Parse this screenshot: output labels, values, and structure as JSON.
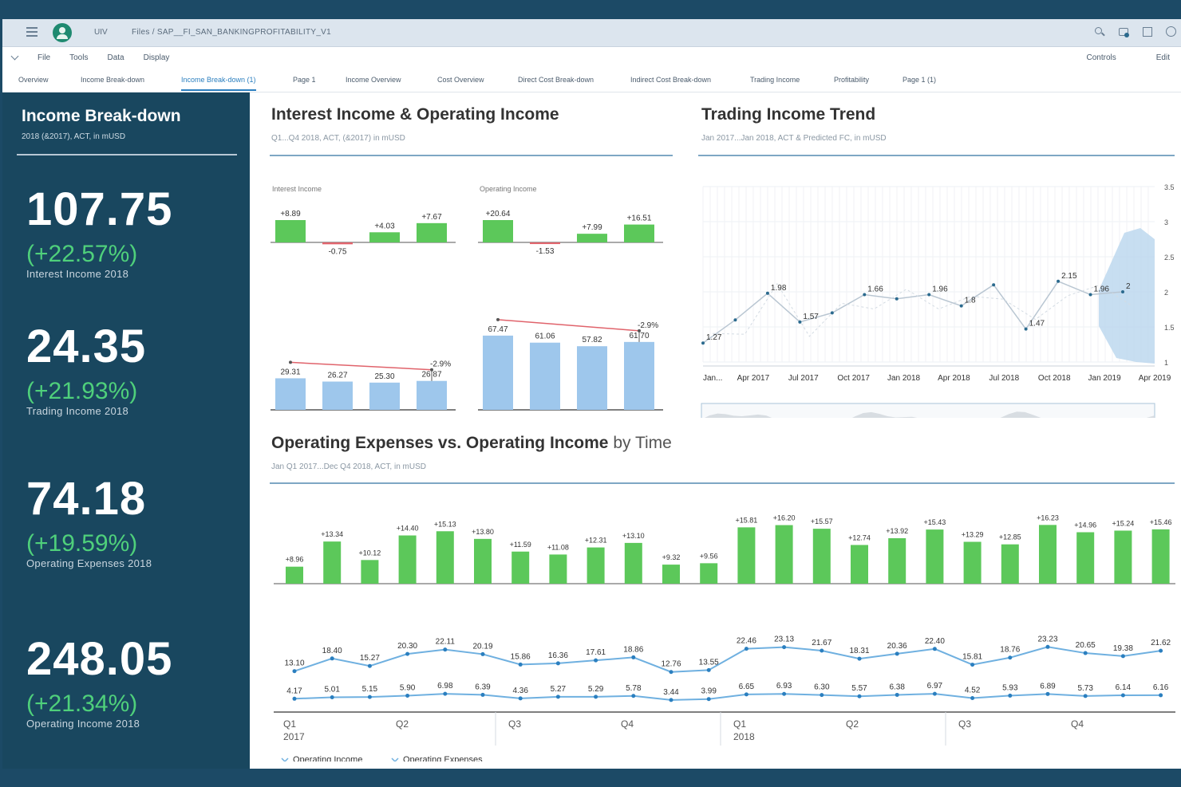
{
  "shell": {
    "app": "UIV",
    "breadcrumb": "Files / SAP__FI_SAN_BANKINGPROFITABILITY_V1"
  },
  "menu": {
    "items": [
      "File",
      "Tools",
      "Data",
      "Display"
    ],
    "right": [
      "Controls",
      "Edit"
    ]
  },
  "tabs": [
    "Overview",
    "Income Break-down",
    "Income Break-down (1)",
    "Page 1",
    "Income Overview",
    "Cost Overview",
    "Direct Cost Break-down",
    "Indirect Cost Break-down",
    "Trading Income",
    "Profitability",
    "Page 1 (1)"
  ],
  "active_tab": "Income Break-down (1)",
  "kpi_panel": {
    "title": "Income Break-down",
    "subtitle": "2018 (&2017), ACT, in mUSD",
    "kpis": [
      {
        "value": "107.75",
        "change": "(+22.57%)",
        "label": "Interest Income 2018"
      },
      {
        "value": "24.35",
        "change": "(+21.93%)",
        "label": "Trading Income 2018"
      },
      {
        "value": "74.18",
        "change": "(+19.59%)",
        "label": "Operating Expenses 2018"
      },
      {
        "value": "248.05",
        "change": "(+21.34%)",
        "label": "Operating Income 2018"
      }
    ]
  },
  "interest_chart": {
    "title": "Interest Income & Operating Income",
    "subtitle": "Q1...Q4 2018, ACT, (&2017) in mUSD"
  },
  "trend_chart": {
    "title": "Trading Income Trend",
    "subtitle": "Jan 2017...Jan 2018, ACT & Predicted FC, in mUSD"
  },
  "opex_chart": {
    "title": "Operating Expenses vs. Operating Income",
    "title_suffix": "by Time",
    "subtitle": "Jan Q1 2017...Dec Q4 2018, ACT, in mUSD",
    "legend": [
      "Operating Income",
      "Operating Expenses"
    ]
  },
  "colors": {
    "panel": "#19475f",
    "green": "#5cc85a",
    "negative": "#e0636b",
    "bar_blue": "#9ec7ec",
    "line_blue": "#6fb0e0",
    "accent": "#2b7fbf"
  },
  "chart_data": [
    {
      "type": "bar",
      "title": "Interest Income",
      "categories": [
        "Q1",
        "Q2",
        "Q3",
        "Q4"
      ],
      "variance_values": [
        8.89,
        -0.75,
        4.03,
        7.67
      ],
      "variance_labels": [
        "+8.89",
        "-0.75",
        "+4.03",
        "+7.67"
      ],
      "values": [
        29.31,
        26.27,
        25.3,
        26.87
      ],
      "value_labels": [
        "29.31",
        "26.27",
        "25.30",
        "26.87"
      ],
      "trend_label": "-2.9%",
      "ylim": [
        0,
        40
      ]
    },
    {
      "type": "bar",
      "title": "Operating Income",
      "categories": [
        "Q1",
        "Q2",
        "Q3",
        "Q4"
      ],
      "variance_values": [
        20.64,
        -1.53,
        7.99,
        16.51
      ],
      "variance_labels": [
        "+20.64",
        "-1.53",
        "+7.99",
        "+16.51"
      ],
      "values": [
        67.47,
        61.06,
        57.82,
        61.7
      ],
      "value_labels": [
        "67.47",
        "61.06",
        "57.82",
        "61.70"
      ],
      "trend_label": "-2.9%",
      "ylim": [
        0,
        80
      ]
    },
    {
      "type": "line",
      "title": "Trading Income Trend",
      "x": [
        "Jan...",
        "Apr 2017",
        "Jul 2017",
        "Oct 2017",
        "Jan 2018",
        "Apr 2018",
        "Jul 2018",
        "Oct 2018",
        "Jan 2019",
        "Apr 2019"
      ],
      "series": [
        {
          "values": [
            1.27,
            1.6,
            1.98,
            1.57,
            1.7,
            1.96,
            1.9,
            1.96,
            1.8,
            2.1,
            1.47,
            2.15,
            1.96,
            2.0
          ]
        }
      ],
      "point_labels": [
        {
          "i": 0,
          "t": "1.27"
        },
        {
          "i": 2,
          "t": "1.98"
        },
        {
          "i": 3,
          "t": "1.57"
        },
        {
          "i": 5,
          "t": "1.66"
        },
        {
          "i": 7,
          "t": "1.96"
        },
        {
          "i": 8,
          "t": "1.8"
        },
        {
          "i": 10,
          "t": "1.47"
        },
        {
          "i": 11,
          "t": "2.15"
        },
        {
          "i": 12,
          "t": "1.96"
        },
        {
          "i": 13,
          "t": "2"
        }
      ],
      "y_ticks": [
        "3.5",
        "3",
        "2.5",
        "2",
        "1.5",
        "1"
      ],
      "ylim": [
        1,
        3.5
      ]
    },
    {
      "type": "bar",
      "title": "Operating Expenses vs. Operating Income",
      "x_groups": [
        {
          "quarter": "Q1",
          "year": "2017"
        },
        {
          "quarter": "Q2",
          "year": ""
        },
        {
          "quarter": "Q3",
          "year": ""
        },
        {
          "quarter": "Q4",
          "year": ""
        },
        {
          "quarter": "Q1",
          "year": "2018"
        },
        {
          "quarter": "Q2",
          "year": ""
        },
        {
          "quarter": "Q3",
          "year": ""
        },
        {
          "quarter": "Q4",
          "year": ""
        }
      ],
      "variance_values": [
        8.96,
        13.34,
        10.12,
        14.4,
        15.13,
        13.8,
        11.59,
        11.08,
        12.31,
        13.1,
        9.32,
        9.56,
        15.81,
        16.2,
        15.57,
        12.74,
        13.92,
        15.43,
        13.29,
        12.85,
        16.23,
        14.96,
        15.24,
        15.46
      ],
      "variance_labels": [
        "+8.96",
        "+13.34",
        "+10.12",
        "+14.40",
        "+15.13",
        "+13.80",
        "+11.59",
        "+11.08",
        "+12.31",
        "+13.10",
        "+9.32",
        "+9.56",
        "+15.81",
        "+16.20",
        "+15.57",
        "+12.74",
        "+13.92",
        "+15.43",
        "+13.29",
        "+12.85",
        "+16.23",
        "+14.96",
        "+15.24",
        "+15.46"
      ],
      "series": [
        {
          "name": "Operating Income",
          "values": [
            13.1,
            18.4,
            15.27,
            20.3,
            22.11,
            20.19,
            15.86,
            16.36,
            17.61,
            18.86,
            12.76,
            13.55,
            22.46,
            23.13,
            21.67,
            18.31,
            20.36,
            22.4,
            15.81,
            18.76,
            23.23,
            20.65,
            19.38,
            21.62
          ],
          "labels": [
            "13.10",
            "18.40",
            "15.27",
            "20.30",
            "22.11",
            "20.19",
            "15.86",
            "16.36",
            "17.61",
            "18.86",
            "12.76",
            "13.55",
            "22.46",
            "23.13",
            "21.67",
            "18.31",
            "20.36",
            "22.40",
            "15.81",
            "18.76",
            "23.23",
            "20.65",
            "19.38",
            "21.62"
          ]
        },
        {
          "name": "Operating Expenses",
          "values": [
            4.17,
            5.01,
            5.15,
            5.9,
            6.98,
            6.39,
            4.36,
            5.27,
            5.29,
            5.78,
            3.44,
            3.99,
            6.65,
            6.93,
            6.3,
            5.57,
            6.38,
            6.97,
            4.52,
            5.93,
            6.89,
            5.73,
            6.14,
            6.16
          ],
          "labels": [
            "4.17",
            "5.01",
            "5.15",
            "5.90",
            "6.98",
            "6.39",
            "4.36",
            "5.27",
            "5.29",
            "5.78",
            "3.44",
            "3.99",
            "6.65",
            "6.93",
            "6.30",
            "5.57",
            "6.38",
            "6.97",
            "4.52",
            "5.93",
            "6.89",
            "5.73",
            "6.14",
            "6.16"
          ]
        }
      ]
    }
  ]
}
